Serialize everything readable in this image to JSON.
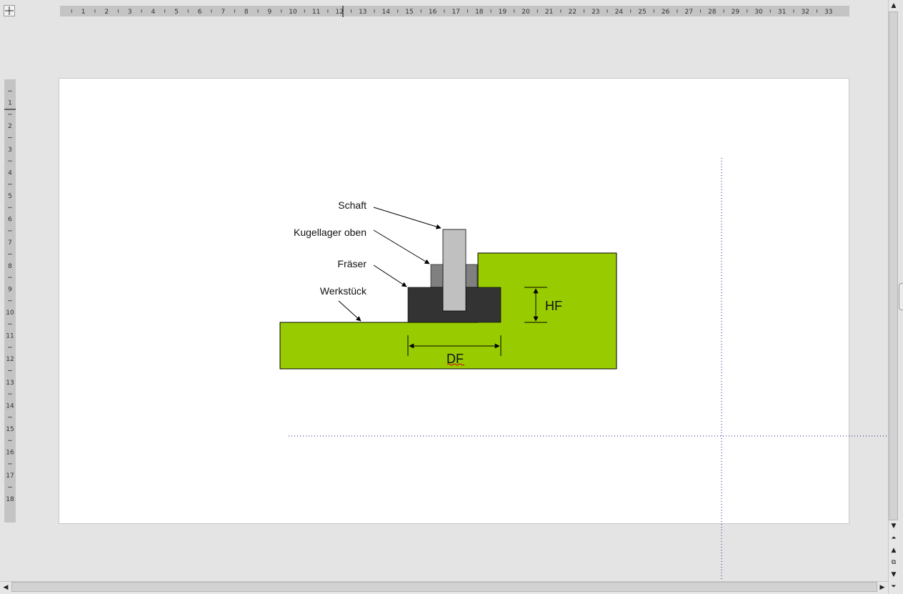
{
  "rulers": {
    "horizontal_labels": [
      "1",
      "2",
      "3",
      "4",
      "5",
      "6",
      "7",
      "8",
      "9",
      "10",
      "11",
      "12",
      "13",
      "14",
      "15",
      "16",
      "17",
      "18",
      "19",
      "20",
      "21",
      "22",
      "23",
      "24",
      "25",
      "26",
      "27",
      "28",
      "29",
      "30",
      "31",
      "32",
      "33"
    ],
    "vertical_labels": [
      "1",
      "2",
      "3",
      "4",
      "5",
      "6",
      "7",
      "8",
      "9",
      "10",
      "11",
      "12",
      "13",
      "14",
      "15",
      "16",
      "17",
      "18"
    ]
  },
  "diagram": {
    "labels": {
      "schaft": "Schaft",
      "kugellager": "Kugellager oben",
      "fraeser": "Fräser",
      "werkstueck": "Werkstück"
    },
    "dimensions": {
      "hf": "HF",
      "df": "DF"
    },
    "colors": {
      "workpiece": "#99cc00",
      "cutter": "#333333",
      "bearing": "#808080",
      "shaft": "#c0c0c0",
      "guide_line": "#1a1a7a"
    }
  }
}
